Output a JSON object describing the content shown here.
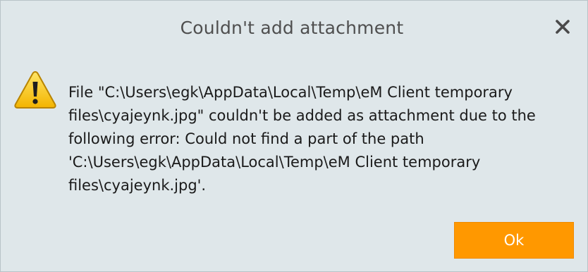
{
  "dialog": {
    "title": "Couldn't add attachment",
    "close_icon": "close-icon",
    "warning_icon": "warning-icon",
    "message_lines": [
      "File \"C:\\Users\\egk\\AppData\\Local\\Temp\\eM Client temporary",
      "files\\cyajeynk.jpg\" couldn't be added as attachment due to the",
      "following error: Could not find a part of the path",
      "'C:\\Users\\egk\\AppData\\Local\\Temp\\eM Client temporary",
      "files\\cyajeynk.jpg'."
    ],
    "ok_label": "Ok",
    "colors": {
      "background": "#dfe7ea",
      "ok_button": "#ff9800",
      "title_text": "#4f4f4f"
    }
  }
}
